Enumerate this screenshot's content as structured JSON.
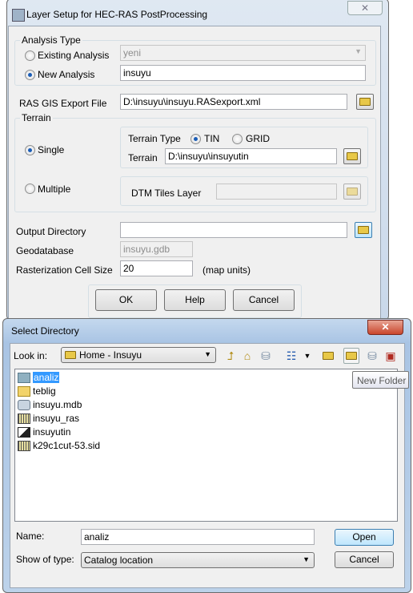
{
  "layer_setup": {
    "title": "Layer Setup for HEC-RAS PostProcessing",
    "analysis_type": {
      "label": "Analysis Type",
      "existing_label": "Existing Analysis",
      "existing_value": "yeni",
      "new_label": "New Analysis",
      "new_value": "insuyu",
      "selected": "New Analysis"
    },
    "ras_export": {
      "label": "RAS GIS Export File",
      "value": "D:\\insuyu\\insuyu.RASexport.xml"
    },
    "terrain": {
      "label": "Terrain",
      "single_label": "Single",
      "multiple_label": "Multiple",
      "selected": "Single",
      "type_label": "Terrain Type",
      "tin_label": "TIN",
      "grid_label": "GRID",
      "type_selected": "TIN",
      "terrain_label": "Terrain",
      "terrain_value": "D:\\insuyu\\insuyutin",
      "dtm_label": "DTM Tiles Layer",
      "dtm_value": ""
    },
    "output_dir": {
      "label": "Output Directory",
      "value": ""
    },
    "geodatabase": {
      "label": "Geodatabase",
      "value": "insuyu.gdb"
    },
    "cell_size": {
      "label": "Rasterization Cell Size",
      "value": "20",
      "unit": "(map units)"
    },
    "buttons": {
      "ok": "OK",
      "help": "Help",
      "cancel": "Cancel"
    }
  },
  "select_dir": {
    "title": "Select Directory",
    "look_in_label": "Look in:",
    "look_in_value": "Home - Insuyu",
    "tooltip": "New Folder",
    "items": [
      {
        "name": "analiz",
        "icon": "folder-icon",
        "selected": true
      },
      {
        "name": "teblig",
        "icon": "folder-icon"
      },
      {
        "name": "insuyu.mdb",
        "icon": "database-icon"
      },
      {
        "name": "insuyu_ras",
        "icon": "raster-icon"
      },
      {
        "name": "insuyutin",
        "icon": "tin-icon"
      },
      {
        "name": "k29c1cut-53.sid",
        "icon": "raster-icon"
      }
    ],
    "name_label": "Name:",
    "name_value": "analiz",
    "type_label": "Show of type:",
    "type_value": "Catalog location",
    "open": "Open",
    "cancel": "Cancel"
  }
}
